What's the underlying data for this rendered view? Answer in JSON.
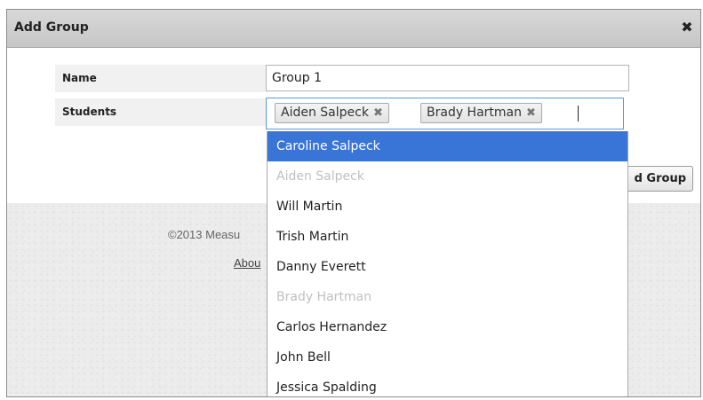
{
  "dialog": {
    "title": "Add Group",
    "close_icon": "close-icon"
  },
  "form": {
    "name_label": "Name",
    "name_value": "Group 1",
    "students_label": "Students",
    "selected_students": [
      {
        "label": "Aiden Salpeck",
        "remove": "✖"
      },
      {
        "label": "Brady Hartman",
        "remove": "✖"
      }
    ],
    "submit_label": "d Group"
  },
  "footer": {
    "copyright": "©2013 Measu",
    "about": "Abou"
  },
  "dropdown": {
    "options": [
      {
        "label": "Caroline Salpeck",
        "state": "highlighted"
      },
      {
        "label": "Aiden Salpeck",
        "state": "disabled"
      },
      {
        "label": "Will Martin",
        "state": "normal"
      },
      {
        "label": "Trish Martin",
        "state": "normal"
      },
      {
        "label": "Danny Everett",
        "state": "normal"
      },
      {
        "label": "Brady Hartman",
        "state": "disabled"
      },
      {
        "label": "Carlos Hernandez",
        "state": "normal"
      },
      {
        "label": "John Bell",
        "state": "normal"
      },
      {
        "label": "Jessica Spalding",
        "state": "normal"
      }
    ]
  },
  "colors": {
    "highlight": "#3875d7",
    "disabled_text": "#c0c0c0",
    "titlebar": "#cccccc",
    "focus_border": "#5b9ad6"
  }
}
